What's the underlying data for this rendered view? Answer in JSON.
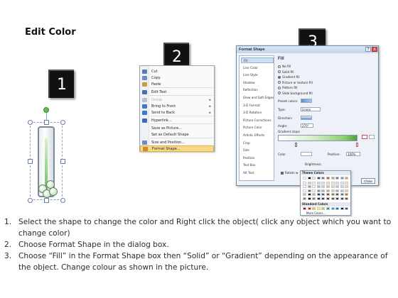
{
  "page": {
    "title": "Edit Color"
  },
  "step_markers": [
    "1",
    "2",
    "3"
  ],
  "context_menu": {
    "items": [
      {
        "label": "Cut",
        "icon": "scissors-icon",
        "color": "#5a7ab0",
        "disabled": false,
        "submenu": false
      },
      {
        "label": "Copy",
        "icon": "copy-icon",
        "color": "#6b8cc4",
        "disabled": false,
        "submenu": false
      },
      {
        "label": "Paste",
        "icon": "paste-icon",
        "color": "#c89b45",
        "disabled": false,
        "submenu": false
      },
      {
        "label": "Edit Text",
        "icon": "edit-text-icon",
        "color": "#4a70b0",
        "disabled": false,
        "submenu": false
      },
      {
        "label": "Group",
        "icon": "group-icon",
        "color": "#b8bec8",
        "disabled": true,
        "submenu": true
      },
      {
        "label": "Bring to Front",
        "icon": "bring-front-icon",
        "color": "#3f78c8",
        "disabled": false,
        "submenu": true
      },
      {
        "label": "Send to Back",
        "icon": "send-back-icon",
        "color": "#3f78c8",
        "disabled": false,
        "submenu": true
      },
      {
        "label": "Hyperlink...",
        "icon": "hyperlink-icon",
        "color": "#3a6ab8",
        "disabled": false,
        "submenu": false
      },
      {
        "label": "Save as Picture...",
        "icon": "",
        "color": "",
        "disabled": false,
        "submenu": false
      },
      {
        "label": "Set as Default Shape",
        "icon": "",
        "color": "",
        "disabled": false,
        "submenu": false
      },
      {
        "label": "Size and Position...",
        "icon": "size-icon",
        "color": "#6a8fc0",
        "disabled": false,
        "submenu": false
      },
      {
        "label": "Format Shape...",
        "icon": "format-shape-icon",
        "color": "#d08a2a",
        "disabled": false,
        "submenu": false,
        "highlighted": true
      }
    ]
  },
  "dialog": {
    "title": "Format Shape",
    "help_button": "?",
    "close_button": "X",
    "nav": [
      "Fill",
      "Line Color",
      "Line Style",
      "Shadow",
      "Reflection",
      "Glow and Soft Edges",
      "3-D Format",
      "3-D Rotation",
      "Picture Corrections",
      "Picture Color",
      "Artistic Effects",
      "Crop",
      "Size",
      "Position",
      "Text Box",
      "Alt Text"
    ],
    "selected_nav": "Fill",
    "pane_title": "Fill",
    "fill_options": [
      "No fill",
      "Solid fill",
      "Gradient fill",
      "Picture or texture fill",
      "Pattern fill",
      "Slide background fill"
    ],
    "selected_fill": "Gradient fill",
    "preset_colors_label": "Preset colors:",
    "type_label": "Type:",
    "type_value": "Linear",
    "direction_label": "Direction:",
    "angle_label": "Angle:",
    "angle_value": "270°",
    "gradient_stops_label": "Gradient stops",
    "color_label": "Color",
    "position_label": "Position:",
    "position_value": "100%",
    "brightness_label": "Brightness:",
    "transparency_label": "Transparency:",
    "rotate_label": "Rotate w",
    "close_label": "Close",
    "palette": {
      "theme_header": "Theme Colors",
      "standard_header": "Standard Colors",
      "more_colors": "More Colors...",
      "theme_top": [
        "#ffffff",
        "#000000",
        "#eeece1",
        "#1f497d",
        "#4f81bd",
        "#c0504d",
        "#9bbb59",
        "#8064a2",
        "#4bacc6",
        "#f79646"
      ],
      "standard": [
        "#c00000",
        "#ff0000",
        "#ffc000",
        "#ffff00",
        "#92d050",
        "#00b050",
        "#00b0f0",
        "#0070c0",
        "#002060",
        "#7030a0"
      ]
    }
  },
  "instructions": [
    {
      "num": "1.",
      "text": "Select the shape to change the color and Right click the object( click any object which you want to change color)"
    },
    {
      "num": "2.",
      "text": "Choose Format Shape in the dialog box."
    },
    {
      "num": "3.",
      "text": "Choose “Fill” in the Format Shape box then “Solid” or “Gradient” depending on the appearance of the object. Change colour as shown in the picture."
    }
  ]
}
